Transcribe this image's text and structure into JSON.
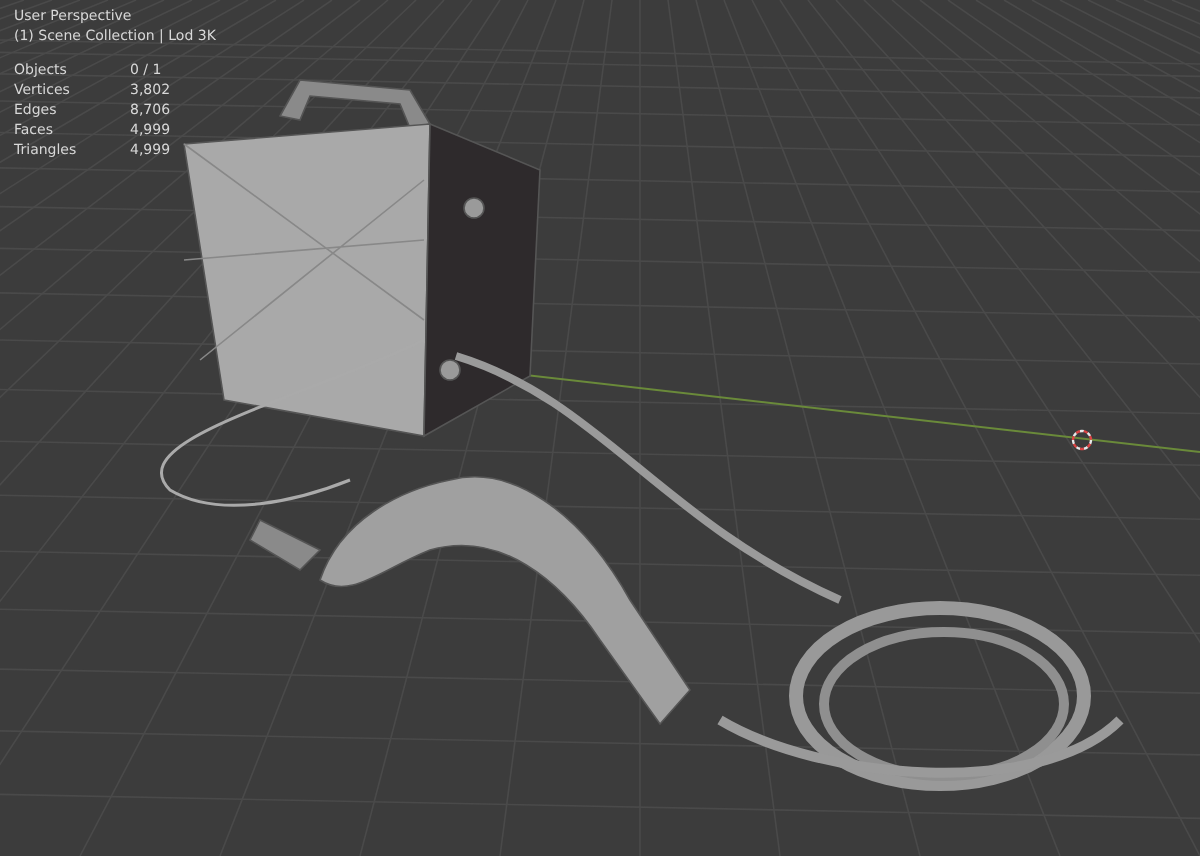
{
  "viewport": {
    "view_name": "User Perspective",
    "collection": "(1) Scene Collection | Lod 3K",
    "stats": [
      {
        "label": "Objects",
        "value": "0 / 1"
      },
      {
        "label": "Vertices",
        "value": "3,802"
      },
      {
        "label": "Edges",
        "value": "8,706"
      },
      {
        "label": "Faces",
        "value": "4,999"
      },
      {
        "label": "Triangles",
        "value": "4,999"
      }
    ]
  }
}
